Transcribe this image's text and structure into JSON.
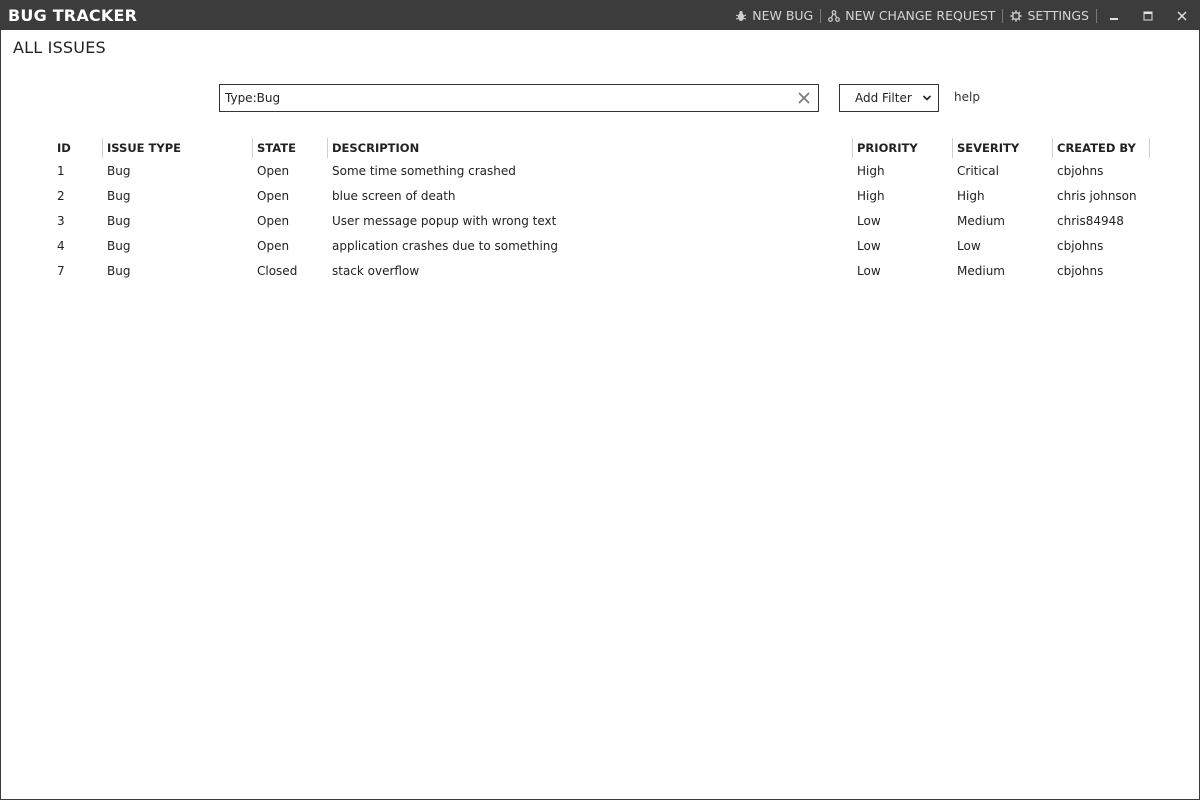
{
  "app": {
    "title": "BUG TRACKER"
  },
  "toolbar": {
    "new_bug": "NEW BUG",
    "new_change_request": "NEW CHANGE REQUEST",
    "settings": "SETTINGS",
    "icons": {
      "new_bug": "bug-icon",
      "new_change_request": "branch-icon",
      "settings": "gear-icon"
    }
  },
  "window_controls": [
    "minimize",
    "maximize",
    "close"
  ],
  "page": {
    "title": "ALL ISSUES"
  },
  "search": {
    "value": "Type:Bug",
    "placeholder": ""
  },
  "filter": {
    "label": "Add Filter"
  },
  "help": {
    "label": "help"
  },
  "table": {
    "columns": [
      "ID",
      "ISSUE TYPE",
      "STATE",
      "DESCRIPTION",
      "PRIORITY",
      "SEVERITY",
      "CREATED BY"
    ],
    "rows": [
      [
        "1",
        "Bug",
        "Open",
        "Some time something crashed",
        "High",
        "Critical",
        "cbjohns"
      ],
      [
        "2",
        "Bug",
        "Open",
        "blue screen of death",
        "High",
        "High",
        "chris johnson"
      ],
      [
        "3",
        "Bug",
        "Open",
        "User message popup with wrong text",
        "Low",
        "Medium",
        "chris84948"
      ],
      [
        "4",
        "Bug",
        "Open",
        "application crashes due to something",
        "Low",
        "Low",
        "cbjohns"
      ],
      [
        "7",
        "Bug",
        "Closed",
        "stack overflow",
        "Low",
        "Medium",
        "cbjohns"
      ]
    ]
  },
  "colors": {
    "titlebar": "#3c3c3c",
    "text": "#222222",
    "background": "#ffffff"
  }
}
